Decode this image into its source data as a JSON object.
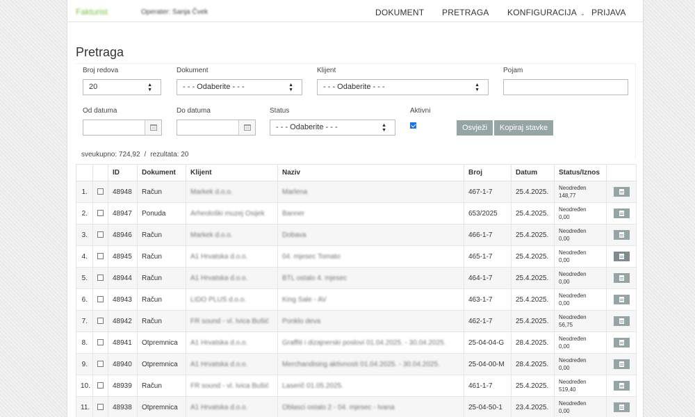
{
  "nav": {
    "brand": "Fakturist",
    "operator": "Operater: Sanja Čvek",
    "links": [
      "DOKUMENT",
      "PRETRAGA",
      "KONFIGURACIJA",
      "PRIJAVA"
    ]
  },
  "page_title": "Pretraga",
  "filters": {
    "broj_redova": {
      "label": "Broj redova",
      "value": "20"
    },
    "dokument": {
      "label": "Dokument",
      "value": "- - - Odaberite - - -"
    },
    "klijent": {
      "label": "Klijent",
      "value": "- - - Odaberite - - -"
    },
    "pojam": {
      "label": "Pojam",
      "value": ""
    },
    "od_datuma": {
      "label": "Od datuma",
      "value": ""
    },
    "do_datuma": {
      "label": "Do datuma",
      "value": ""
    },
    "status": {
      "label": "Status",
      "value": "- - - Odaberite - - -"
    },
    "aktivni": {
      "label": "Aktivni",
      "checked": true
    }
  },
  "buttons": {
    "refresh": "Osvježi",
    "copy": "Kopiraj stavke"
  },
  "summary": {
    "total": "sveukupno: 724,92",
    "separator": "/",
    "results": "rezultata: 20"
  },
  "table": {
    "headers": [
      "",
      "",
      "ID",
      "Dokument",
      "Klijent",
      "Naziv",
      "Broj",
      "Datum",
      "Status/Iznos",
      ""
    ],
    "rows": [
      {
        "n": "1.",
        "id": "48948",
        "doc": "Račun",
        "client": "Markek d.o.o.",
        "name": "Marlena",
        "broj": "467-1-7",
        "date": "25.4.2025.",
        "status": "Neodređen",
        "amount": "148,77"
      },
      {
        "n": "2.",
        "id": "48947",
        "doc": "Ponuda",
        "client": "Arheološki muzej Osijek",
        "name": "Banner",
        "broj": "653/2025",
        "date": "25.4.2025.",
        "status": "Neodređen",
        "amount": "0,00"
      },
      {
        "n": "3.",
        "id": "48946",
        "doc": "Račun",
        "client": "Markek d.o.o.",
        "name": "Dobava",
        "broj": "466-1-7",
        "date": "25.4.2025.",
        "status": "Neodređen",
        "amount": "0,00"
      },
      {
        "n": "4.",
        "id": "48945",
        "doc": "Račun",
        "client": "A1 Hrvatska d.o.o.",
        "name": "04. mjesec Tomato",
        "broj": "465-1-7",
        "date": "25.4.2025.",
        "status": "Neodređen",
        "amount": "0,00"
      },
      {
        "n": "5.",
        "id": "48944",
        "doc": "Račun",
        "client": "A1 Hrvatska d.o.o.",
        "name": "BTL ostalo 4. mjesec",
        "broj": "464-1-7",
        "date": "25.4.2025.",
        "status": "Neodređen",
        "amount": "0,00"
      },
      {
        "n": "6.",
        "id": "48943",
        "doc": "Račun",
        "client": "LIDO PLUS d.o.o.",
        "name": "King Sale - AV",
        "broj": "463-1-7",
        "date": "25.4.2025.",
        "status": "Neodređen",
        "amount": "0,00"
      },
      {
        "n": "7.",
        "id": "48942",
        "doc": "Račun",
        "client": "FR sound - vl. Ivica Bušić",
        "name": "Ponklo deva",
        "broj": "462-1-7",
        "date": "25.4.2025.",
        "status": "Neodređen",
        "amount": "56,75"
      },
      {
        "n": "8.",
        "id": "48941",
        "doc": "Otpremnica",
        "client": "A1 Hrvatska d.o.o.",
        "name": "Graffiti i dizajnerski poslovi 01.04.2025. - 30.04.2025.",
        "broj": "25-04-04-G",
        "date": "28.4.2025.",
        "status": "Neodređen",
        "amount": "0,00"
      },
      {
        "n": "9.",
        "id": "48940",
        "doc": "Otpremnica",
        "client": "A1 Hrvatska d.o.o.",
        "name": "Merchandising aktivnosti 01.04.2025. - 30.04.2025.",
        "broj": "25-04-00-M",
        "date": "28.4.2025.",
        "status": "Neodređen",
        "amount": "0,00"
      },
      {
        "n": "10.",
        "id": "48939",
        "doc": "Račun",
        "client": "FR sound - vl. Ivica Bušić",
        "name": "Laserič 01.05.2025.",
        "broj": "461-1-7",
        "date": "25.4.2025.",
        "status": "Neodređen",
        "amount": "519,40"
      },
      {
        "n": "11.",
        "id": "48938",
        "doc": "Otpremnica",
        "client": "A1 Hrvatska d.o.o.",
        "name": "Oblasci ostalo 2 - 04. mjesec - Ivana",
        "broj": "25-04-50-1",
        "date": "23.4.2025.",
        "status": "Neodređen",
        "amount": "0,00"
      }
    ]
  }
}
